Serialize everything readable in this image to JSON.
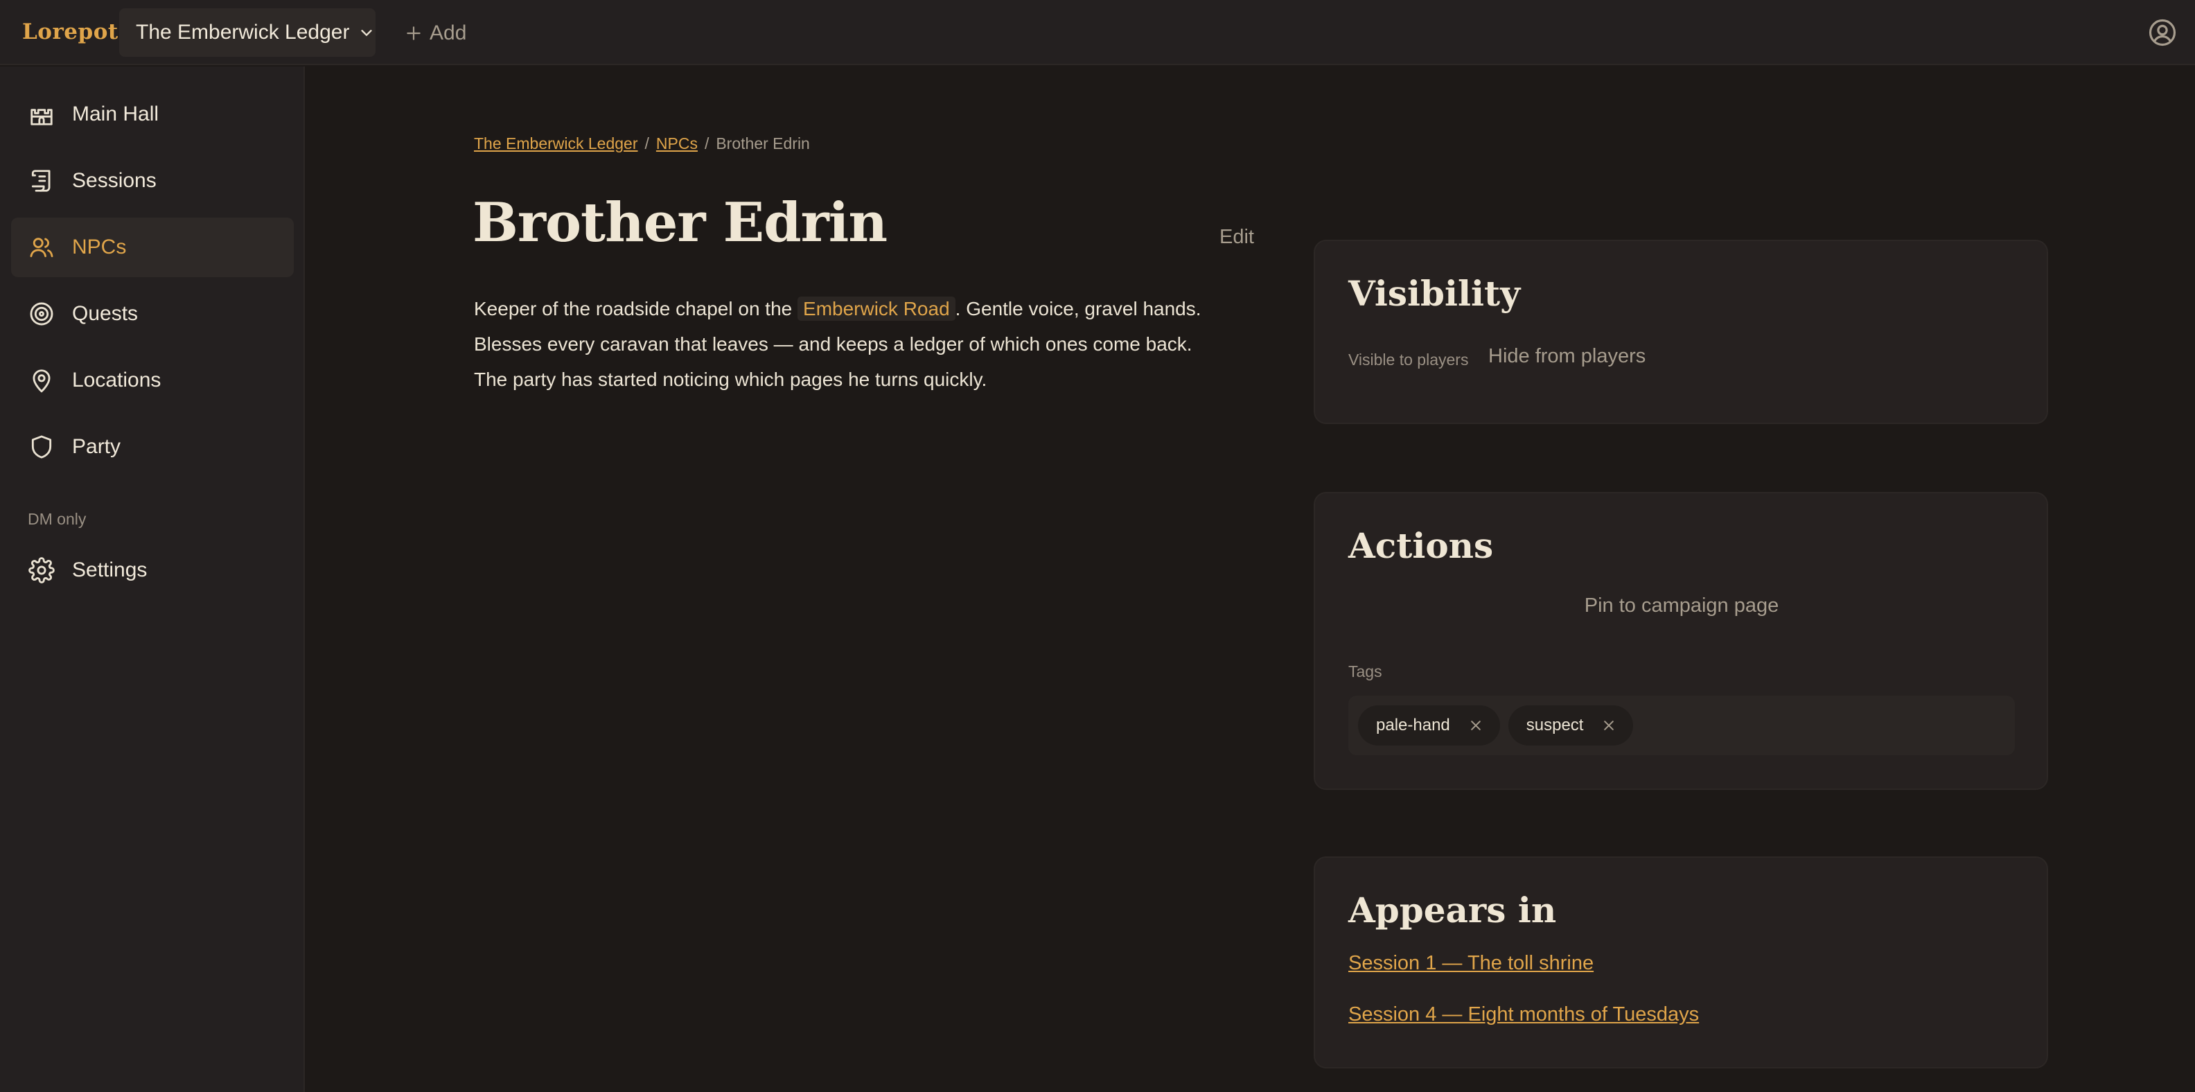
{
  "app": {
    "logo": "Lorepot",
    "campaign": "The Emberwick Ledger",
    "add_label": "Add"
  },
  "sidebar": {
    "items": [
      {
        "label": "Main Hall",
        "icon": "castle-icon"
      },
      {
        "label": "Sessions",
        "icon": "scroll-icon"
      },
      {
        "label": "NPCs",
        "icon": "users-icon",
        "active": true
      },
      {
        "label": "Quests",
        "icon": "target-icon"
      },
      {
        "label": "Locations",
        "icon": "map-pin-icon"
      },
      {
        "label": "Party",
        "icon": "shield-icon"
      }
    ],
    "section_label": "DM only",
    "settings_label": "Settings"
  },
  "breadcrumb": {
    "root": "The Emberwick Ledger",
    "section": "NPCs",
    "current": "Brother Edrin",
    "separator": "/"
  },
  "page": {
    "title": "Brother Edrin",
    "edit_label": "Edit",
    "description_before": "Keeper of the roadside chapel on the",
    "mention": "Emberwick Road",
    "description_after": ". Gentle voice, gravel hands. Blesses every caravan that leaves — and keeps a ledger of which ones come back. The party has started noticing which pages he turns quickly."
  },
  "visibility": {
    "heading": "Visibility",
    "status": "Visible to players",
    "toggle_label": "Hide from players"
  },
  "actions": {
    "heading": "Actions",
    "pin_label": "Pin to campaign page",
    "tags_label": "Tags",
    "tags": [
      "pale-hand",
      "suspect"
    ]
  },
  "appears_in": {
    "heading": "Appears in",
    "links": [
      "Session 1 — The toll shrine",
      "Session 4 — Eight months of Tuesdays"
    ]
  },
  "colors": {
    "accent": "#e0a54a",
    "background": "#1d1917",
    "panel": "#242020",
    "card": "#262120",
    "text": "#ebe3d3",
    "muted": "#a79d8e"
  }
}
